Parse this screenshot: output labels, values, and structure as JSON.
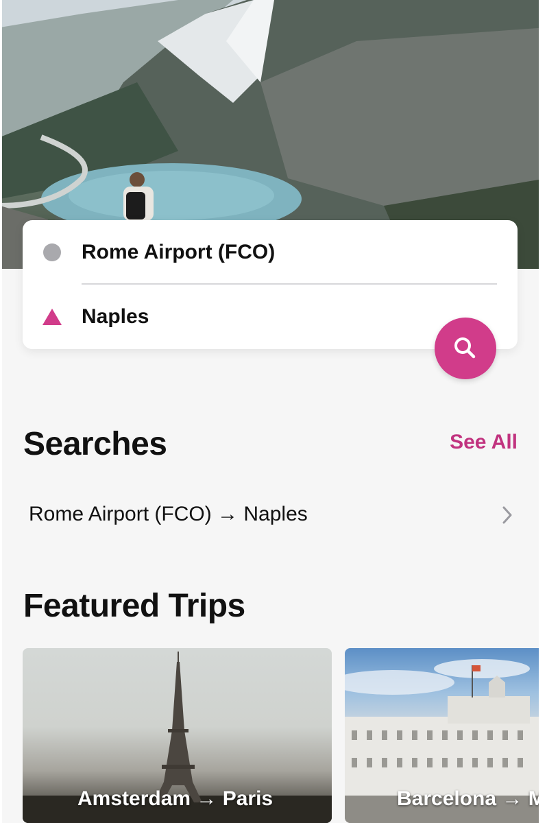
{
  "search": {
    "origin": "Rome Airport (FCO)",
    "destination": "Naples"
  },
  "searches": {
    "title": "Searches",
    "see_all": "See All",
    "items": [
      {
        "label": "Rome Airport (FCO) → Naples"
      }
    ]
  },
  "featured": {
    "title": "Featured Trips",
    "trips": [
      {
        "label": "Amsterdam → Paris"
      },
      {
        "label": "Barcelona → M"
      }
    ]
  },
  "colors": {
    "accent": "#d13c8a",
    "origin_dot": "#a9a9ad",
    "background": "#f6f6f6"
  },
  "icons": {
    "origin": "circle-icon",
    "destination": "triangle-icon",
    "search": "magnifier-icon",
    "chevron": "chevron-right-icon"
  }
}
